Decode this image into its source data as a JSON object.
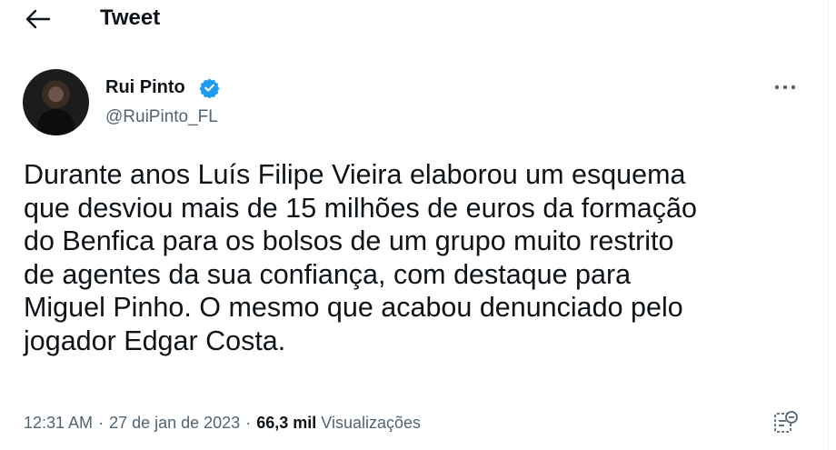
{
  "header": {
    "title": "Tweet",
    "back_icon": "arrow-left-icon"
  },
  "author": {
    "name": "Rui Pinto",
    "handle": "@RuiPinto_FL",
    "verified_icon": "verified-badge-icon",
    "verified_color": "#1d9bf0"
  },
  "tweet": {
    "lines": [
      "Durante anos Luís Filipe Vieira elaborou um esquema",
      "que desviou mais de 15 milhões de euros da formação",
      "do Benfica para os bolsos de um grupo muito restrito",
      "de agentes da sua confiança, com destaque para",
      "Miguel Pinho. O mesmo que acabou denunciado pelo",
      "jogador Edgar Costa."
    ]
  },
  "meta": {
    "time": "12:31 AM",
    "date": "27 de jan de 2023",
    "separator": "·",
    "views_count": "66,3 mil",
    "views_label": "Visualizações"
  },
  "icons": {
    "more": "more-options-icon",
    "analytics": "analytics-icon"
  },
  "colors": {
    "text": "#0f1419",
    "secondary": "#536471",
    "accent": "#1d9bf0"
  }
}
